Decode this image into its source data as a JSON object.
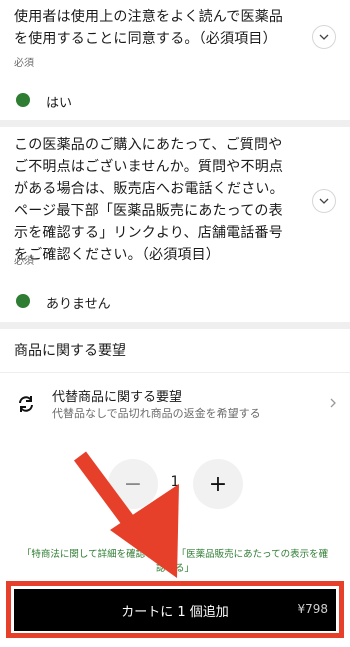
{
  "question1": {
    "line1": "使用者は使用上の注意をよく読んで医薬品",
    "line2": "を使用することに同意する。（必須項目）",
    "required": "必須",
    "answer": "はい"
  },
  "question2": {
    "line1": "この医薬品のご購入にあたって、ご質問や",
    "line2": "ご不明点はございませんか。質問や不明点",
    "line3": "がある場合は、販売店へお電話ください。",
    "line4": "ページ最下部「医薬品販売にあたっての表",
    "line5": "示を確認する」リンクより、店舗電話番号",
    "line6": "をご確認ください。（必須項目）",
    "required": "必須",
    "answer": "ありません"
  },
  "product_requests": {
    "section_title": "商品に関する要望",
    "substitute_title": "代替商品に関する要望",
    "substitute_subtitle": "代替品なしで品切れ商品の返金を希望する"
  },
  "quantity": {
    "minus": "−",
    "value": "1",
    "plus": "+"
  },
  "legal": {
    "line1": "「特商法に関して詳細を確認する」,「医薬品販売にあたっての表示を確",
    "line2": "認する」"
  },
  "cart": {
    "label": "カートに 1 個追加",
    "price": "¥798"
  },
  "colors": {
    "accent_green": "#2e7d32",
    "annotation_red": "#e6402a"
  }
}
